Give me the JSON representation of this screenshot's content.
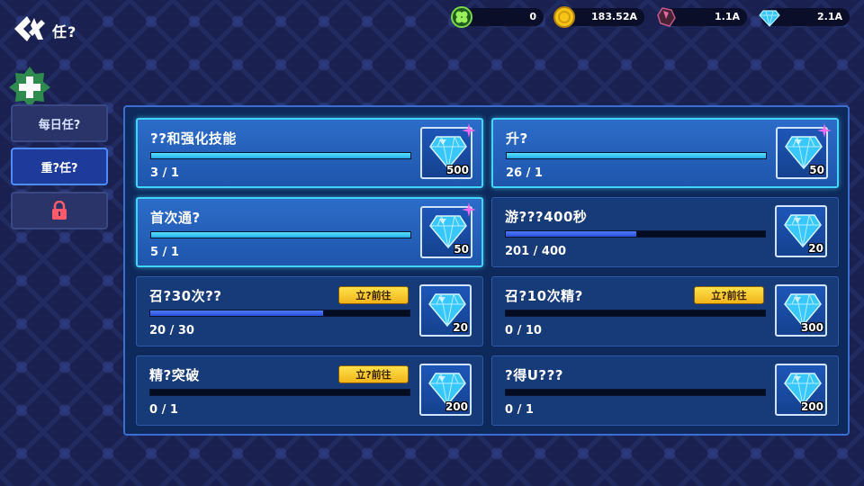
{
  "header": {
    "title": "任?",
    "currencies": [
      {
        "name": "clover",
        "icon": "clover-icon",
        "value": "0"
      },
      {
        "name": "gold",
        "icon": "gold-coin-icon",
        "value": "183.52A"
      },
      {
        "name": "crystal",
        "icon": "red-crystal-icon",
        "value": "1.1A"
      },
      {
        "name": "diamond",
        "icon": "diamond-icon",
        "value": "2.1A"
      }
    ]
  },
  "sidebar": {
    "tabs": [
      {
        "label": "每日任?",
        "state": "inactive"
      },
      {
        "label": "重?任?",
        "state": "active"
      },
      {
        "label": "",
        "state": "locked",
        "icon": "lock-icon"
      }
    ]
  },
  "tasks": [
    {
      "name": "??和强化技能",
      "progress_text": "3 / 1",
      "progress": 1.0,
      "reward": "500",
      "done": true,
      "goto_label": ""
    },
    {
      "name": "升?",
      "progress_text": "26 / 1",
      "progress": 1.0,
      "reward": "50",
      "done": true,
      "goto_label": ""
    },
    {
      "name": "首次通?",
      "progress_text": "5 / 1",
      "progress": 1.0,
      "reward": "50",
      "done": true,
      "goto_label": ""
    },
    {
      "name": "游???400秒",
      "progress_text": "201 / 400",
      "progress": 0.5025,
      "reward": "20",
      "done": false,
      "goto_label": ""
    },
    {
      "name": "召?30次??",
      "progress_text": "20 / 30",
      "progress": 0.6667,
      "reward": "20",
      "done": false,
      "goto_label": "立?前往"
    },
    {
      "name": "召?10次精?",
      "progress_text": "0 / 10",
      "progress": 0.0,
      "reward": "300",
      "done": false,
      "goto_label": "立?前往"
    },
    {
      "name": "精?突破",
      "progress_text": "0 / 1",
      "progress": 0.0,
      "reward": "200",
      "done": false,
      "goto_label": "立?前往"
    },
    {
      "name": "?得U???",
      "progress_text": "0 / 1",
      "progress": 0.0,
      "reward": "200",
      "done": false,
      "goto_label": ""
    }
  ],
  "colors": {
    "accent": "#42d4ff",
    "button": "#f0b419",
    "background": "#1a2150"
  }
}
